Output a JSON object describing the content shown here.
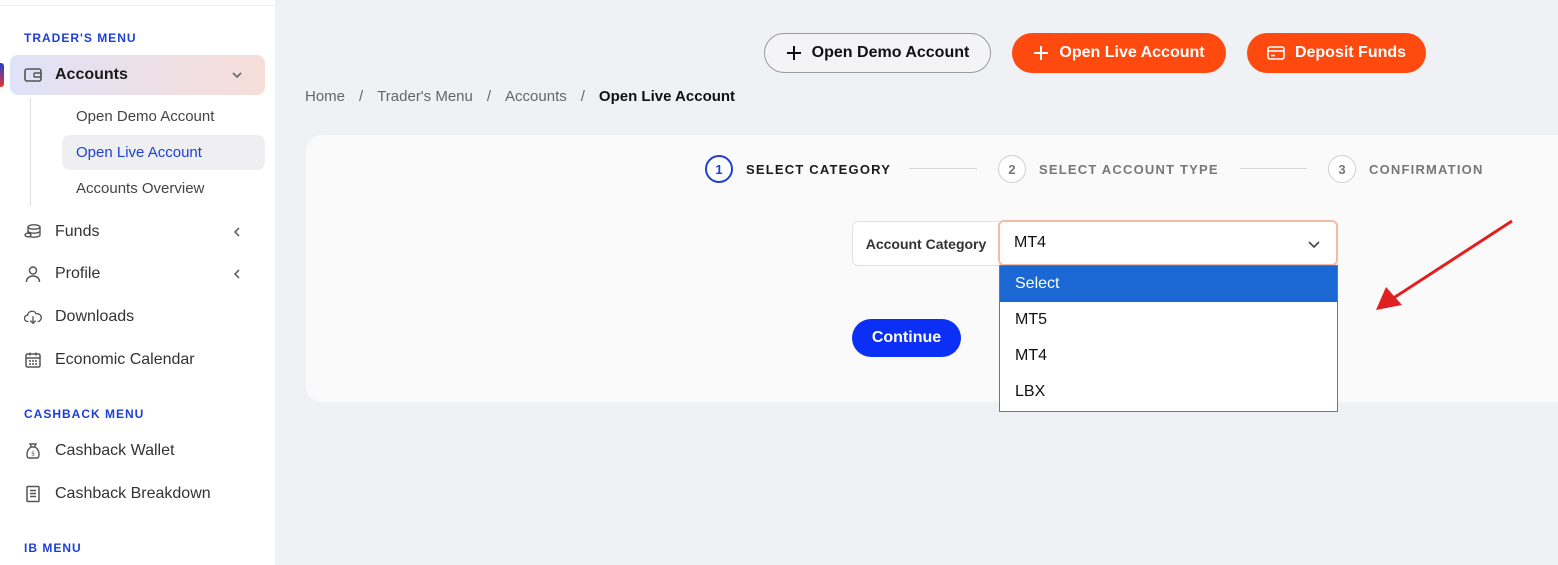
{
  "sidebar": {
    "traders_menu_title": "TRADER'S MENU",
    "accounts": {
      "label": "Accounts",
      "icon": "wallet-icon",
      "sub_items": [
        {
          "label": "Open Demo Account"
        },
        {
          "label": "Open Live Account"
        },
        {
          "label": "Accounts Overview"
        }
      ]
    },
    "items": [
      {
        "label": "Funds",
        "icon": "coins-icon"
      },
      {
        "label": "Profile",
        "icon": "user-icon"
      },
      {
        "label": "Downloads",
        "icon": "cloud-download-icon"
      },
      {
        "label": "Economic Calendar",
        "icon": "calendar-icon"
      }
    ],
    "cashback_menu_title": "CASHBACK MENU",
    "cashback_items": [
      {
        "label": "Cashback Wallet",
        "icon": "money-bag-icon"
      },
      {
        "label": "Cashback Breakdown",
        "icon": "receipt-icon"
      }
    ],
    "ib_menu_title": "IB MENU"
  },
  "header": {
    "demo_button": "Open Demo Account",
    "live_button": "Open Live Account",
    "deposit_button": "Deposit Funds"
  },
  "breadcrumb": [
    "Home",
    "Trader's Menu",
    "Accounts",
    "Open Live Account"
  ],
  "stepper": [
    {
      "number": "1",
      "label": "SELECT CATEGORY"
    },
    {
      "number": "2",
      "label": "SELECT ACCOUNT TYPE"
    },
    {
      "number": "3",
      "label": "CONFIRMATION"
    }
  ],
  "form": {
    "label": "Account Category",
    "selected_value": "MT4",
    "options": [
      "Select",
      "MT5",
      "MT4",
      "LBX"
    ],
    "highlighted_option": "Select",
    "continue_button": "Continue"
  },
  "colors": {
    "accent_blue": "#1d3fd6",
    "orange": "#ff4a0f",
    "continue_blue": "#0b2ff5",
    "arrow_red": "#e02020"
  }
}
